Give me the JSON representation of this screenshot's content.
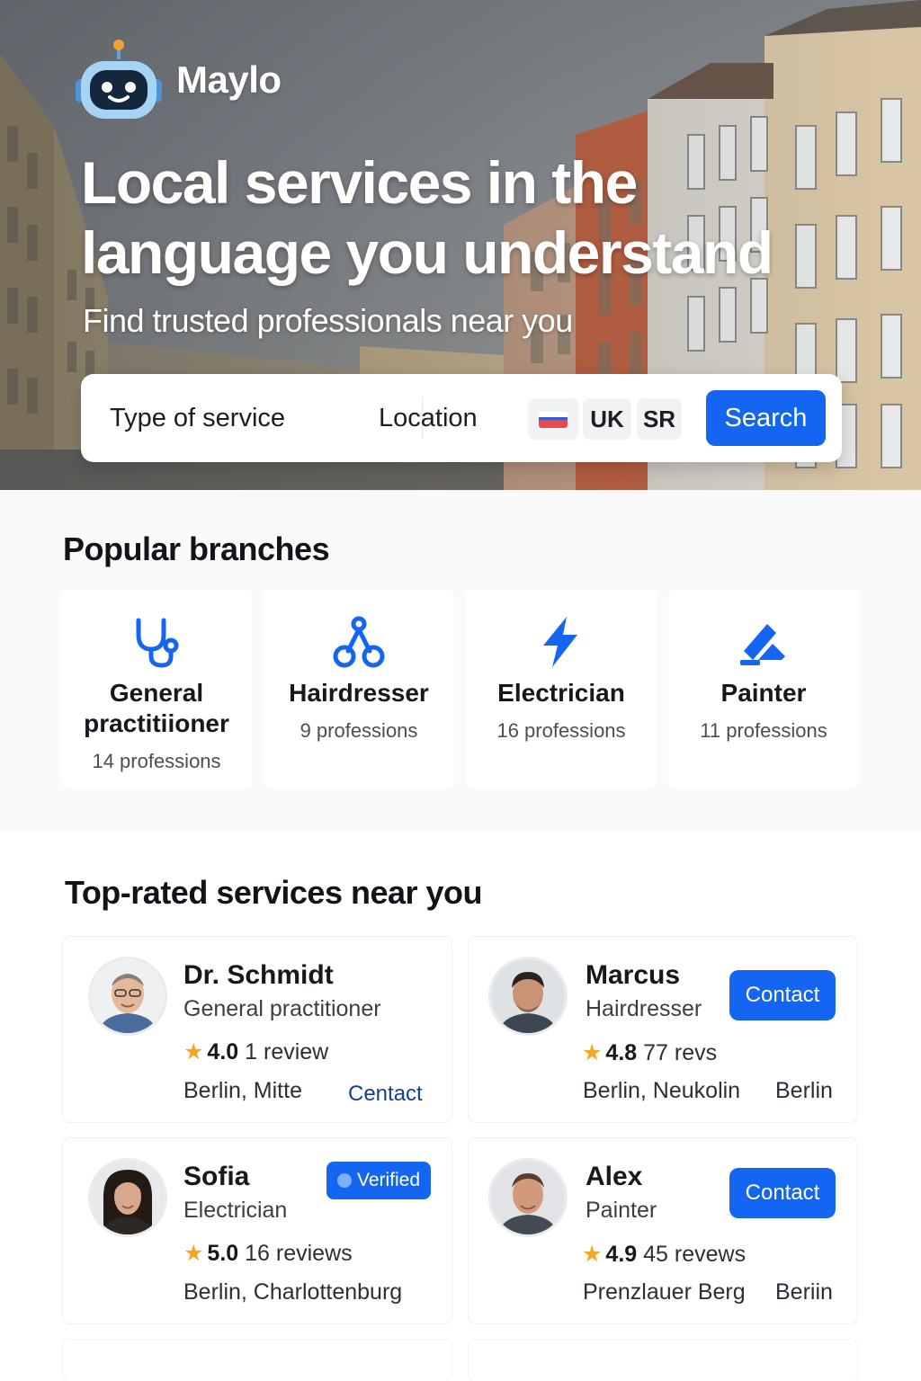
{
  "brand": {
    "name": "Maylo"
  },
  "hero": {
    "title_line1": "Local services in the",
    "title_line2": "language you understand",
    "subtitle": "Find trusted professionals near you"
  },
  "search": {
    "service_label": "Type of service",
    "location_label": "Location",
    "languages": [
      "UK",
      "SR"
    ],
    "button": "Search"
  },
  "branches": {
    "title": "Popular branches",
    "items": [
      {
        "name_line1": "General",
        "name_line2": "practitiioner",
        "count": "14 professions",
        "icon": "stethoscope-icon"
      },
      {
        "name_line1": "Hairdresser",
        "count": "9 professions",
        "icon": "scissors-icon"
      },
      {
        "name_line1": "Electrician",
        "count": "16 professions",
        "icon": "lightning-icon"
      },
      {
        "name_line1": "Painter",
        "count": "11 professions",
        "icon": "paint-roller-icon"
      }
    ]
  },
  "providers": {
    "title": "Top-rated services near you",
    "items": [
      {
        "name": "Dr. Schmidt",
        "profession": "General practitioner",
        "rating": "4.0",
        "reviews": "1 review",
        "location": "Berlin, Mitte",
        "action": "Centact"
      },
      {
        "name": "Marcus",
        "profession": "Hairdresser",
        "rating": "4.8",
        "reviews": "77 revs",
        "location": "Berlin, Neukolin",
        "location2": "Berlin",
        "action": "Contact"
      },
      {
        "name": "Sofia",
        "profession": "Electrician",
        "rating": "5.0",
        "reviews": "16 reviews",
        "location": "Berlin, Charlottenburg",
        "badge": "Verified"
      },
      {
        "name": "Alex",
        "profession": "Painter",
        "rating": "4.9",
        "reviews": "45 revews",
        "location": "Prenzlauer Berg",
        "location2": "Beriin",
        "action": "Contact"
      }
    ]
  },
  "colors": {
    "primary": "#1466f2",
    "star": "#f5a623",
    "hero_overlay": "#7d8287"
  }
}
